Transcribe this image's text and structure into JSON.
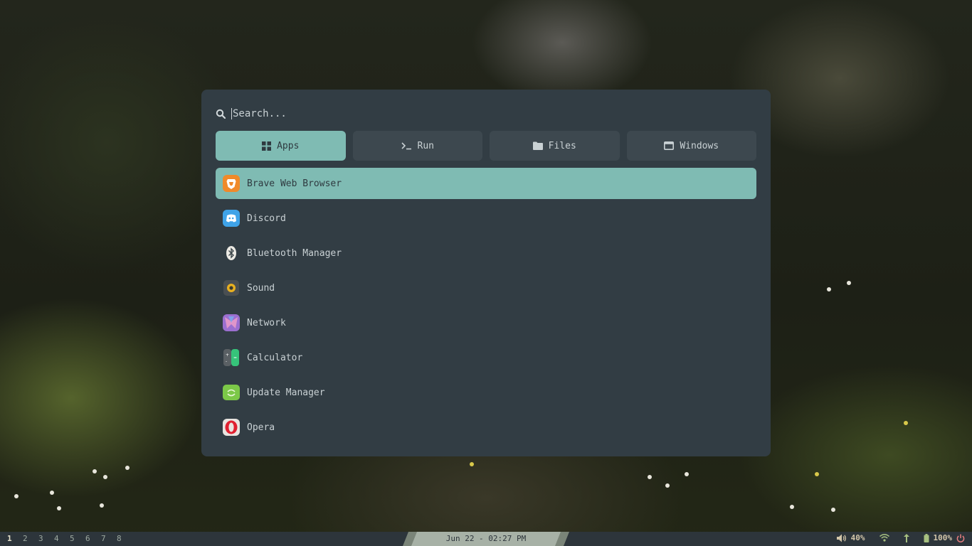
{
  "search": {
    "placeholder": "Search..."
  },
  "tabs": [
    {
      "label": "Apps",
      "icon": "grid-icon",
      "active": true
    },
    {
      "label": "Run",
      "icon": "terminal-icon",
      "active": false
    },
    {
      "label": "Files",
      "icon": "folder-icon",
      "active": false
    },
    {
      "label": "Windows",
      "icon": "window-icon",
      "active": false
    }
  ],
  "apps": [
    {
      "label": "Brave Web Browser",
      "icon": "brave-icon",
      "selected": true
    },
    {
      "label": "Discord",
      "icon": "discord-icon"
    },
    {
      "label": "Bluetooth Manager",
      "icon": "bluetooth-icon"
    },
    {
      "label": "Sound",
      "icon": "sound-icon"
    },
    {
      "label": "Network",
      "icon": "network-icon"
    },
    {
      "label": "Calculator",
      "icon": "calculator-icon"
    },
    {
      "label": "Update Manager",
      "icon": "update-manager-icon"
    },
    {
      "label": "Opera",
      "icon": "opera-icon"
    }
  ],
  "taskbar": {
    "workspaces": [
      "1",
      "2",
      "3",
      "4",
      "5",
      "6",
      "7",
      "8"
    ],
    "active_workspace": "1",
    "clock": "Jun 22 - 02:27 PM",
    "volume": "40%",
    "battery": "100%"
  },
  "colors": {
    "accent": "#7fbbb3",
    "panel": "#323d44",
    "tab": "#3d484f",
    "bar": "#2d353b"
  }
}
